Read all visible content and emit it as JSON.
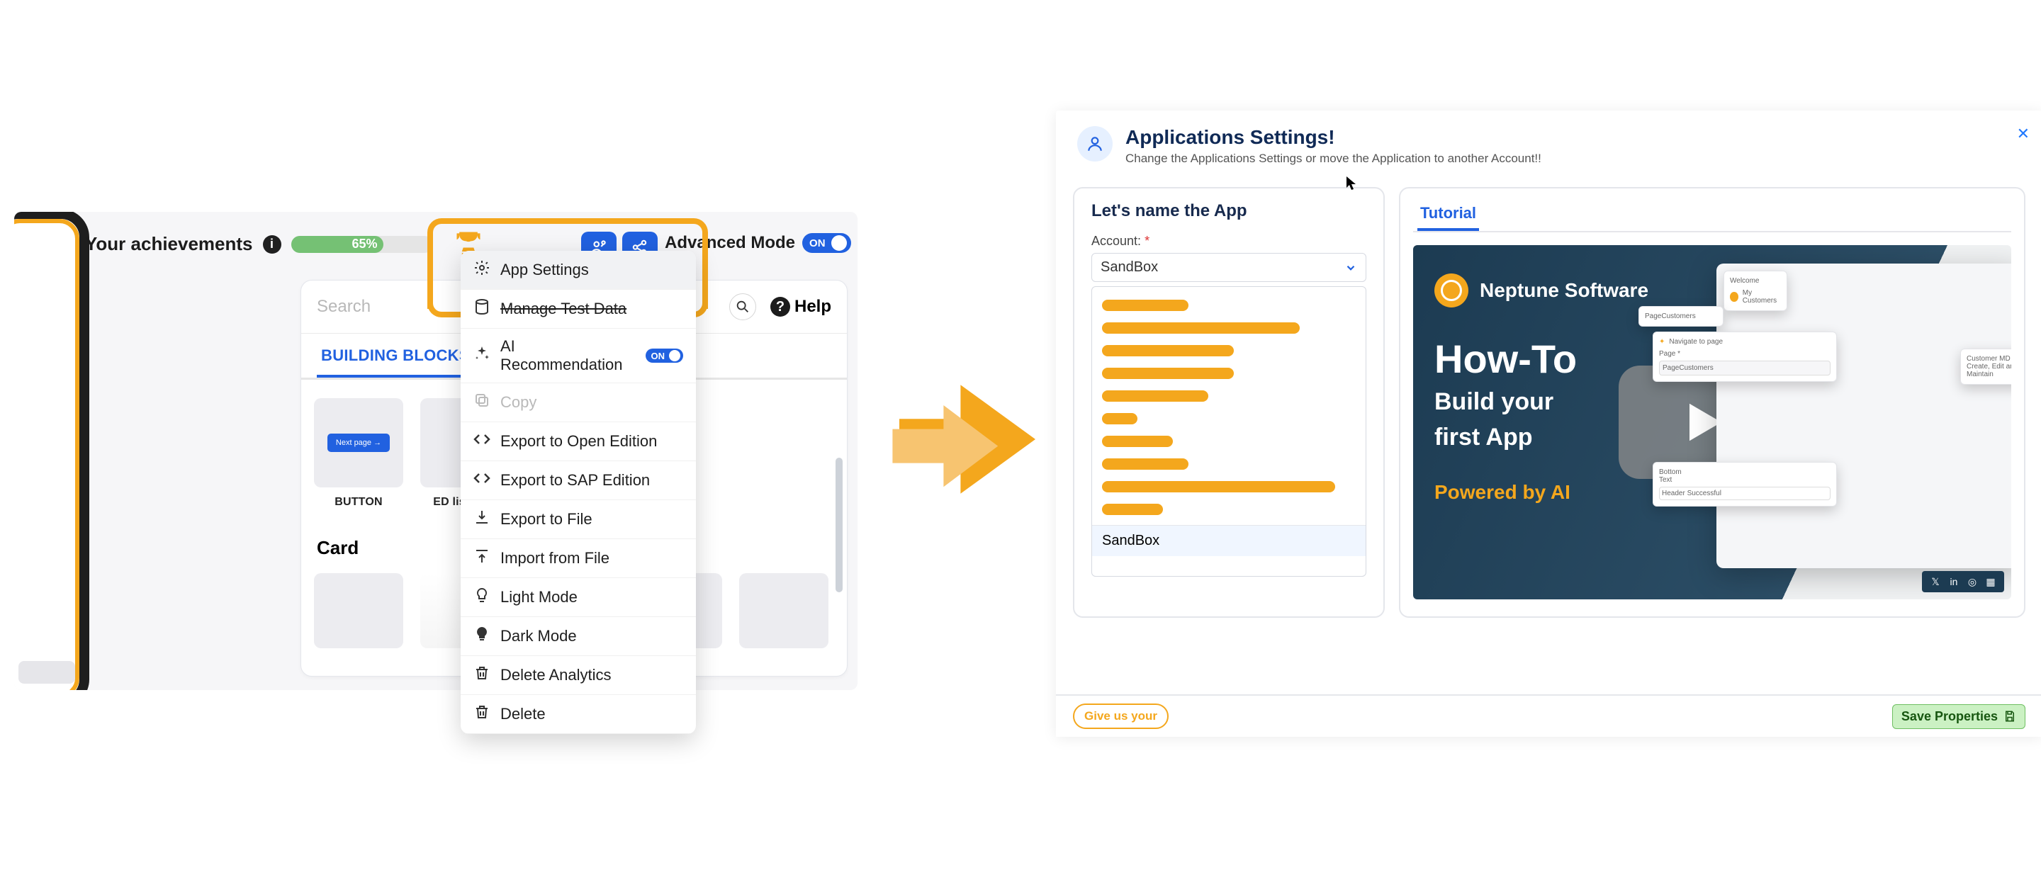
{
  "left": {
    "achievements_label": "Your achievements",
    "progress_pct": "65%",
    "pill_buttons": [
      "user-share",
      "share"
    ],
    "advanced_mode_label": "Advanced Mode",
    "advanced_mode_toggle": "ON",
    "search_placeholder": "Search",
    "help_label": "Help",
    "tab_building_blocks": "BUILDING BLOCKS",
    "gallery_items": [
      {
        "label": "BUTTON",
        "badge": "Next page →"
      },
      {
        "label": "ED list item"
      }
    ],
    "card_heading": "Card"
  },
  "menu": {
    "items": [
      {
        "icon": "gear",
        "label": "App Settings",
        "highlight": true
      },
      {
        "icon": "db",
        "label": "Manage Test Data",
        "strike": true
      },
      {
        "icon": "sparkle",
        "label": "AI Recommendation",
        "toggle": "ON"
      },
      {
        "icon": "copy",
        "label": "Copy",
        "disabled": true
      },
      {
        "icon": "code",
        "label": "Export to Open Edition"
      },
      {
        "icon": "code",
        "label": "Export to SAP Edition"
      },
      {
        "icon": "export",
        "label": "Export to File"
      },
      {
        "icon": "import",
        "label": "Import from File"
      },
      {
        "icon": "bulb",
        "label": "Light Mode"
      },
      {
        "icon": "bulb-fill",
        "label": "Dark Mode"
      },
      {
        "icon": "trash",
        "label": "Delete Analytics"
      },
      {
        "icon": "trash",
        "label": "Delete"
      }
    ]
  },
  "right": {
    "title": "Applications Settings!",
    "subtitle": "Change the Applications Settings or move the Application to another Account!!",
    "name_heading": "Let's name the App",
    "account_label": "Account:",
    "account_value": "SandBox",
    "dropdown_selected": "SandBox",
    "tutorial_tab": "Tutorial",
    "brand": "Neptune Software",
    "howto_title": "How-To",
    "howto_sub1": "Build your",
    "howto_sub2": "first App",
    "powered": "Powered by AI",
    "mock_labels": {
      "welcome": "Welcome",
      "mycustomers": "My Customers",
      "pagecust": "PageCustomers",
      "navto": "Navigate to page",
      "page": "Page *",
      "customer_md": "Customer MD",
      "maintain": "Create, Edit and Maintain",
      "bottom": "Bottom",
      "text": "Text",
      "header_success": "Header Successful"
    },
    "giveus": "Give us your",
    "saveprops": "Save Properties"
  },
  "skel_widths": [
    "34%",
    "78%",
    "52%",
    "52%",
    "42%",
    "14%",
    "28%",
    "34%",
    "92%",
    "24%"
  ]
}
